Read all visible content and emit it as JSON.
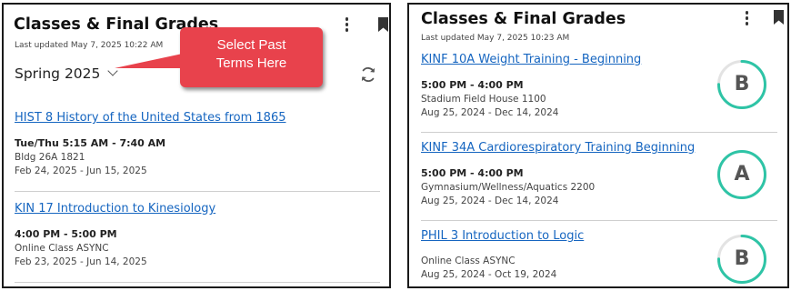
{
  "left_panel": {
    "title": "Classes & Final Grades",
    "last_updated": "Last updated May 7, 2025 10:22 AM",
    "term": "Spring 2025",
    "courses": [
      {
        "name": "HIST 8 History of the United States from 1865",
        "time": "Tue/Thu 5:15 AM - 7:40 AM",
        "location": "Bldg 26A 1821",
        "dates": "Feb 24, 2025 - Jun 15, 2025"
      },
      {
        "name": "KIN 17 Introduction to Kinesiology",
        "time": "4:00 PM - 5:00 PM",
        "location": "Online Class ASYNC",
        "dates": "Feb 23, 2025 - Jun 14, 2025"
      }
    ]
  },
  "callout": {
    "line1": "Select Past",
    "line2": "Terms Here",
    "color": "#e8424c"
  },
  "right_panel": {
    "title": "Classes & Final Grades",
    "last_updated": "Last updated May 7, 2025 10:23 AM",
    "courses": [
      {
        "name": "KINF 10A Weight Training - Beginning",
        "time": "5:00 PM - 4:00 PM",
        "location": "Stadium Field House 1100",
        "dates": "Aug 25, 2024 - Dec 14, 2024",
        "grade": "B",
        "grade_fill": 0.75
      },
      {
        "name": "KINF 34A Cardiorespiratory Training Beginning",
        "time": "5:00 PM - 4:00 PM",
        "location": "Gymnasium/Wellness/Aquatics 2200",
        "dates": "Aug 25, 2024 - Dec 14, 2024",
        "grade": "A",
        "grade_fill": 1.0
      },
      {
        "name": "PHIL 3 Introduction to Logic",
        "location": "Online Class ASYNC",
        "dates": "Aug 25, 2024 - Oct 19, 2024",
        "grade": "B",
        "grade_fill": 0.75
      }
    ]
  },
  "colors": {
    "link": "#1565c0",
    "grade_ring": "#2ec4a6",
    "grade_track": "#e3e3e3"
  },
  "icons": {
    "menu": "kebab-vertical-icon",
    "bookmark": "bookmark-icon",
    "refresh": "refresh-icon",
    "dropdown": "chevron-down-icon"
  }
}
